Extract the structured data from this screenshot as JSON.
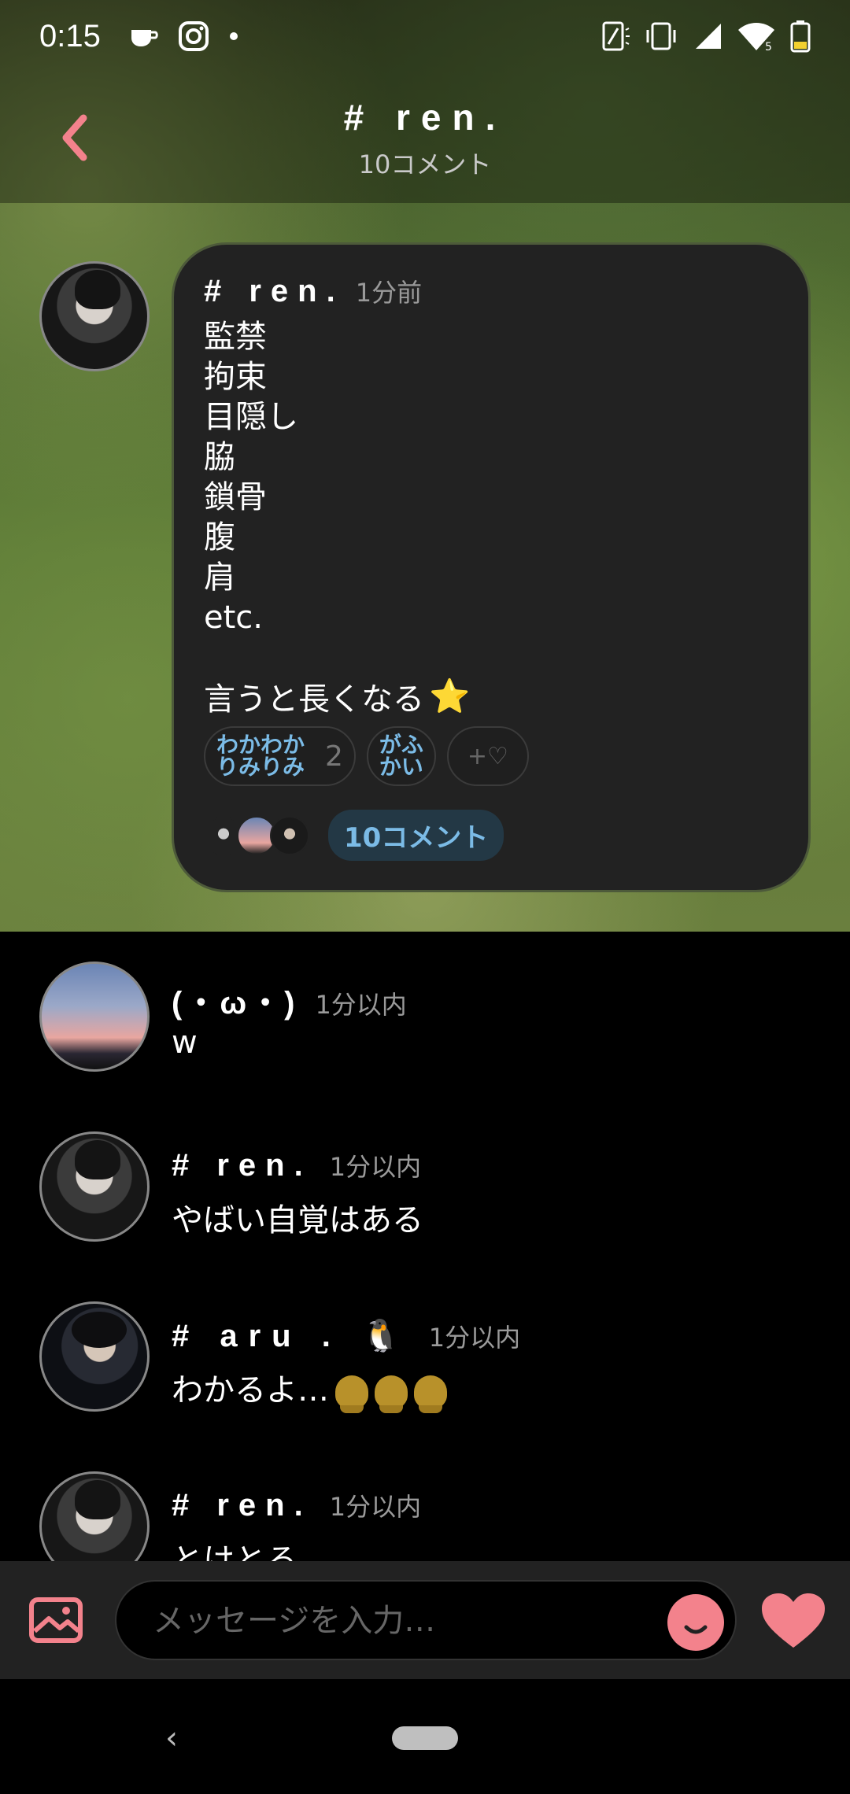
{
  "status_bar": {
    "time": "0:15",
    "left_icons": [
      "coffee-icon",
      "instagram-icon",
      "dot-icon"
    ],
    "right_icons": [
      "nfc-icon",
      "vibrate-icon",
      "signal-icon",
      "wifi-icon",
      "battery-icon"
    ]
  },
  "header": {
    "title": "# ren.",
    "subtitle": "10コメント"
  },
  "post": {
    "author": "# ren.",
    "time": "1分前",
    "lines": [
      "監禁",
      "拘束",
      "目隠し",
      "脇",
      "鎖骨",
      "腹",
      "肩",
      "etc."
    ],
    "final_line": "言うと長くなる",
    "final_emoji": "⭐",
    "reactions": [
      {
        "label": "わかわかりみりみ",
        "count": "2"
      },
      {
        "label": "がふかい",
        "count": ""
      }
    ],
    "add_reaction_label": "+♡",
    "comment_chip": "10コメント"
  },
  "comments": [
    {
      "author": "(・ω・)",
      "time": "1分以内",
      "text": "w"
    },
    {
      "author": "# ren.",
      "time": "1分以内",
      "text": "やばい自覚はある"
    },
    {
      "author": "# aru . 🐧",
      "time": "1分以内",
      "text": "わかるよ…"
    },
    {
      "author": "# ren.",
      "time": "1分以内",
      "text": "とけとる"
    }
  ],
  "input": {
    "placeholder": "メッセージを入力…"
  },
  "colors": {
    "accent": "#f3828c",
    "link": "#7bbbe6",
    "bubble": "#222222"
  }
}
